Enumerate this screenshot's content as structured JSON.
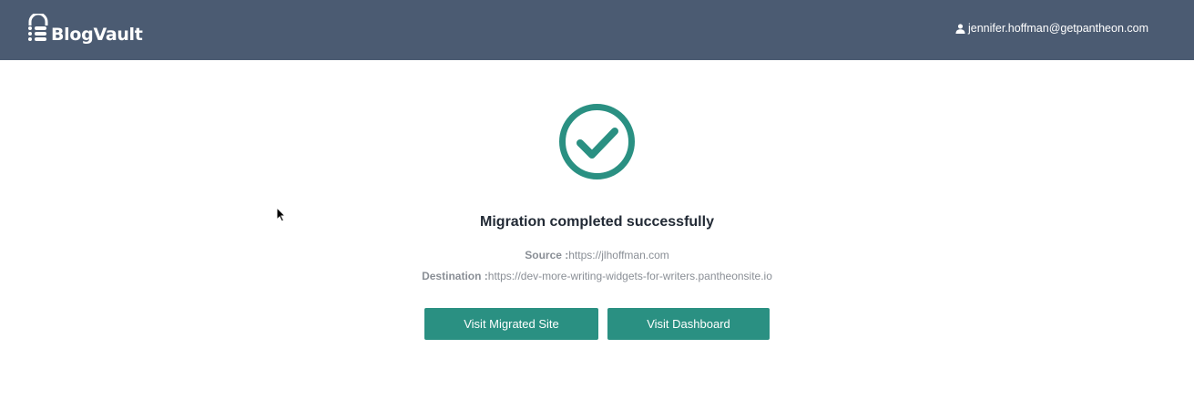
{
  "header": {
    "brand": "BlogVault",
    "user_email": "jennifer.hoffman@getpantheon.com",
    "logo_icon": "lock-stack-icon",
    "user_icon": "user-icon",
    "background_color": "#4b5b72"
  },
  "result": {
    "status_icon": "check-circle-icon",
    "title": "Migration completed successfully",
    "source_label": "Source :",
    "source_value": "https://jlhoffman.com",
    "destination_label": "Destination :",
    "destination_value": "https://dev-more-writing-widgets-for-writers.pantheonsite.io",
    "accent_color": "#2a9082"
  },
  "actions": {
    "visit_site_label": "Visit Migrated Site",
    "visit_dashboard_label": "Visit Dashboard"
  }
}
